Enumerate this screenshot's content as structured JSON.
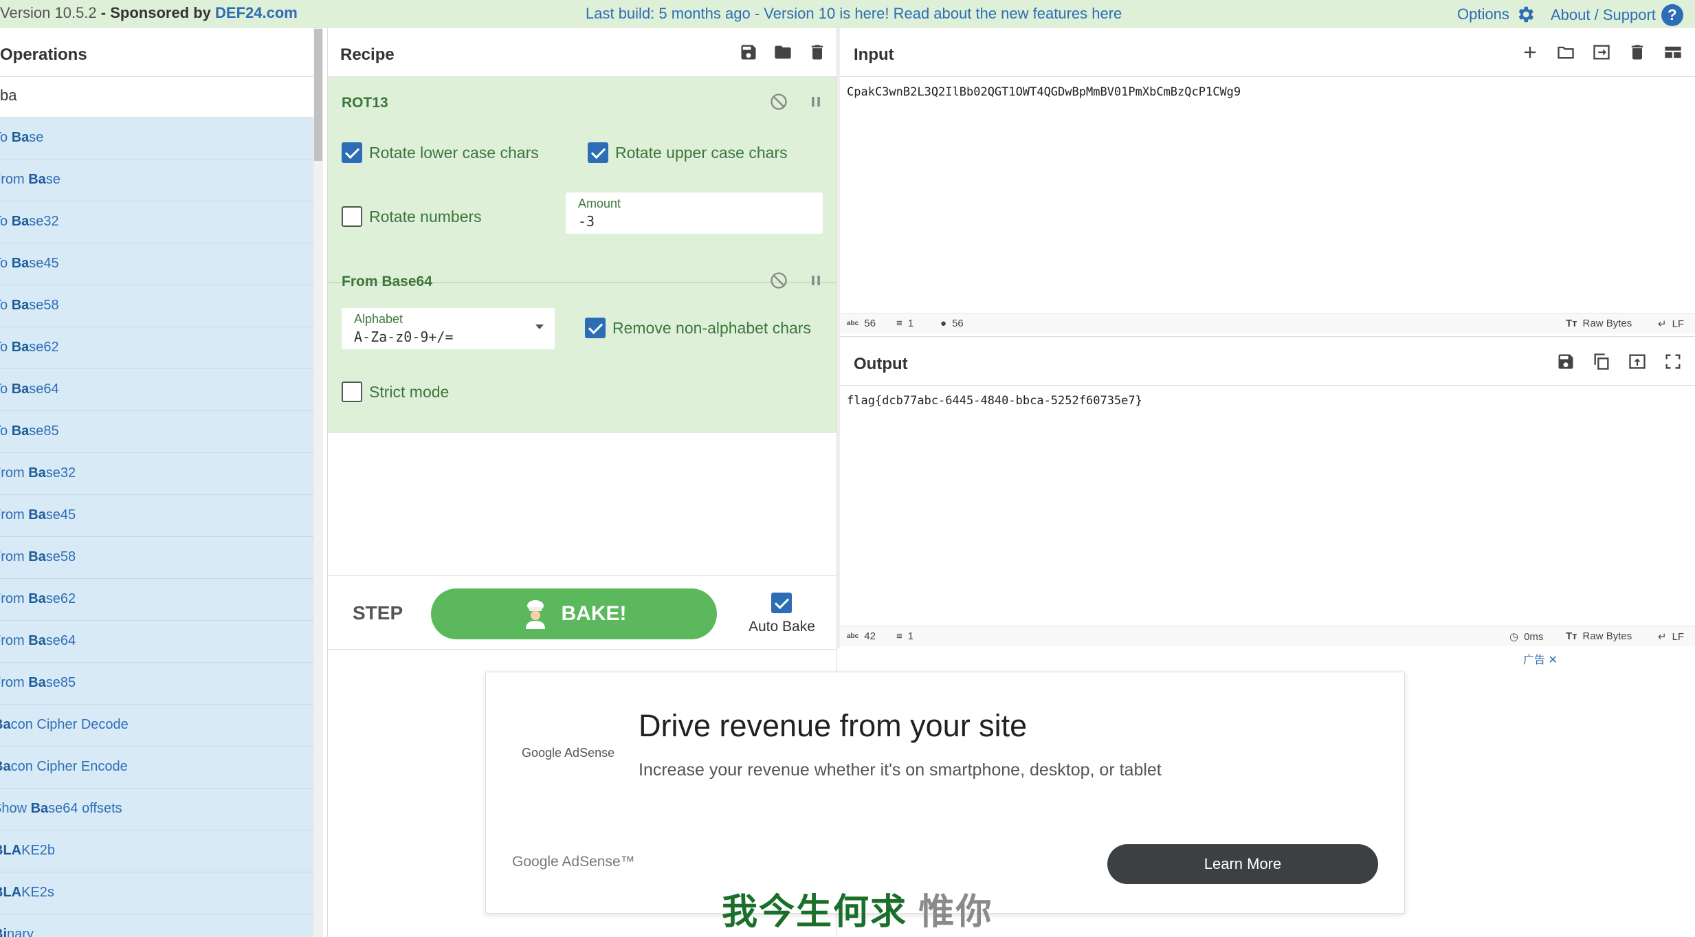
{
  "banner": {
    "version": "Version 10.5.2",
    "sponsored_prefix": " - Sponsored by ",
    "sponsor": "DEF24.com",
    "notice": "Last build: 5 months ago - Version 10 is here! Read about the new features here",
    "options": "Options",
    "about": "About / Support",
    "help_glyph": "?"
  },
  "operations": {
    "title": "Operations",
    "search_value": "ba",
    "items": [
      {
        "pre": "To ",
        "hl": "Ba",
        "post": "se"
      },
      {
        "pre": "From ",
        "hl": "Ba",
        "post": "se"
      },
      {
        "pre": "To ",
        "hl": "Ba",
        "post": "se32"
      },
      {
        "pre": "To ",
        "hl": "Ba",
        "post": "se45"
      },
      {
        "pre": "To ",
        "hl": "Ba",
        "post": "se58"
      },
      {
        "pre": "To ",
        "hl": "Ba",
        "post": "se62"
      },
      {
        "pre": "To ",
        "hl": "Ba",
        "post": "se64"
      },
      {
        "pre": "To ",
        "hl": "Ba",
        "post": "se85"
      },
      {
        "pre": "From ",
        "hl": "Ba",
        "post": "se32"
      },
      {
        "pre": "From ",
        "hl": "Ba",
        "post": "se45"
      },
      {
        "pre": "From ",
        "hl": "Ba",
        "post": "se58"
      },
      {
        "pre": "From ",
        "hl": "Ba",
        "post": "se62"
      },
      {
        "pre": "From ",
        "hl": "Ba",
        "post": "se64"
      },
      {
        "pre": "From ",
        "hl": "Ba",
        "post": "se85"
      },
      {
        "pre": "",
        "hl": "Ba",
        "post": "con Cipher Decode"
      },
      {
        "pre": "",
        "hl": "Ba",
        "post": "con Cipher Encode"
      },
      {
        "pre": "Show ",
        "hl": "Ba",
        "post": "se64 offsets"
      },
      {
        "pre": "",
        "hl": "BLA",
        "post": "KE2b"
      },
      {
        "pre": "",
        "hl": "BLA",
        "post": "KE2s"
      },
      {
        "pre": "",
        "hl": "Bi",
        "post": "nary"
      }
    ]
  },
  "recipe": {
    "title": "Recipe",
    "rot13": {
      "name": "ROT13",
      "lower_label": "Rotate lower case chars",
      "upper_label": "Rotate upper case chars",
      "numbers_label": "Rotate numbers",
      "amount_label": "Amount",
      "amount_value": "-3"
    },
    "base64": {
      "name": "From Base64",
      "alphabet_label": "Alphabet",
      "alphabet_value": "A-Za-z0-9+/=",
      "remove_label": "Remove non-alphabet chars",
      "strict_label": "Strict mode"
    },
    "step_label": "STEP",
    "bake_label": "BAKE!",
    "auto_bake_label": "Auto Bake"
  },
  "input": {
    "title": "Input",
    "text": "CpakC3wnB2L3Q2IlBb02QGT1OWT4QGDwBpMmBV01PmXbCmBzQcP1CWg9",
    "length": "56",
    "lines": "1",
    "position": "56",
    "encoding": "Raw Bytes",
    "eol": "LF"
  },
  "output": {
    "title": "Output",
    "text": "flag{dcb77abc-6445-4840-bbca-5252f60735e7}",
    "length": "42",
    "lines": "1",
    "time": "0ms",
    "encoding": "Raw Bytes",
    "eol": "LF"
  },
  "ad": {
    "tag": "广告",
    "logo": "Google AdSense",
    "headline": "Drive revenue from your site",
    "subtext": "Increase your revenue whether it's on smartphone, desktop, or tablet",
    "brand": "Google AdSense™",
    "cta": "Learn More"
  },
  "overlay": {
    "green": "我今生何求",
    "grey": " 惟你"
  },
  "icons": [
    "gear-icon",
    "help-icon",
    "save-icon",
    "folder-icon",
    "trash-icon",
    "disable-icon",
    "pause-icon",
    "plus-icon",
    "import-icon",
    "layout-icon",
    "copy-icon",
    "replace-input-icon",
    "maximize-icon",
    "clock-icon",
    "location-icon"
  ]
}
